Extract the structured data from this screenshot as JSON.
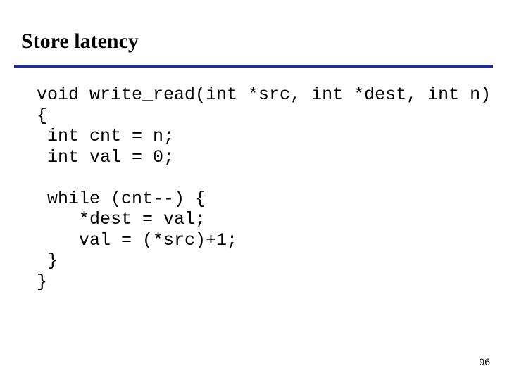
{
  "slide": {
    "title": "Store latency",
    "page_number": "96"
  },
  "code": {
    "l1": "void write_read(int *src, int *dest, int n)",
    "l2": "{",
    "l3": " int cnt = n;",
    "l4": " int val = 0;",
    "l5": "",
    "l6": " while (cnt--) {",
    "l7": "    *dest = val;",
    "l8": "    val = (*src)+1;",
    "l9": " }",
    "l10": "}"
  }
}
